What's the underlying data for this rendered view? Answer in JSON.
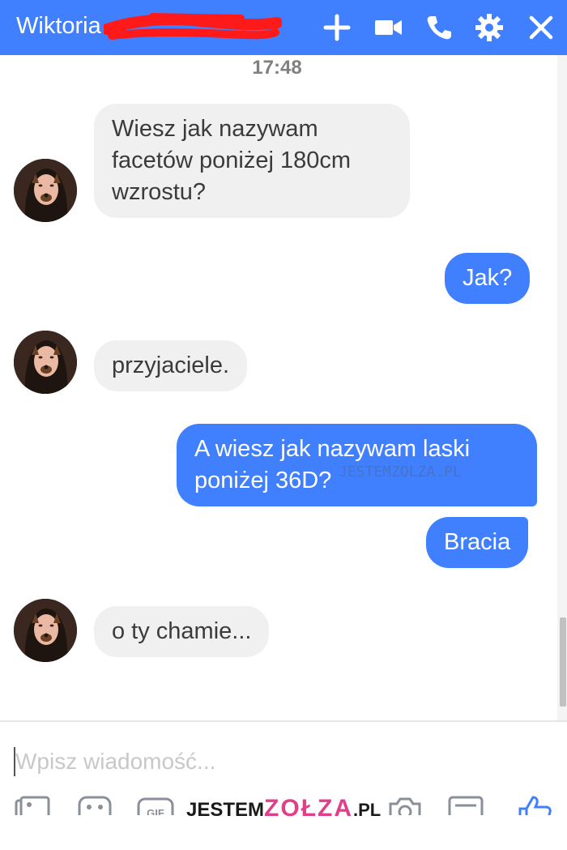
{
  "header": {
    "contact_name": "Wiktoria",
    "bg_color": "#4080ff",
    "icons": [
      "plus-icon",
      "video-camera-icon",
      "phone-icon",
      "gear-icon",
      "close-icon"
    ]
  },
  "conversation": {
    "timestamp": "17:48",
    "messages": [
      {
        "direction": "incoming",
        "lines": [
          "Wiesz jak nazywam",
          "facetów poniżej 180cm",
          "wzrostu?"
        ]
      },
      {
        "direction": "outgoing",
        "lines": [
          "Jak?"
        ]
      },
      {
        "direction": "incoming",
        "lines": [
          "przyjaciele."
        ]
      },
      {
        "direction": "outgoing",
        "lines": [
          "A wiesz jak nazywam laski",
          "poniżej 36D?"
        ]
      },
      {
        "direction": "outgoing",
        "lines": [
          "Bracia"
        ]
      },
      {
        "direction": "incoming",
        "lines": [
          "o ty chamie..."
        ]
      }
    ],
    "incoming_bg": "#f1f0f0",
    "outgoing_bg": "#4080ff"
  },
  "composer": {
    "placeholder": "Wpisz wiadomość...",
    "tools": [
      "image-icon",
      "sticker-icon",
      "gif-icon",
      "camera-icon",
      "emoji-icon",
      "thumbs-up-icon"
    ]
  },
  "watermark": {
    "small": "JESTEMZOLZA.PL",
    "brand_left": "JESTEM",
    "brand_mid": "ZOŁZA",
    "brand_right": ".PL",
    "accent": "#e0408a"
  }
}
